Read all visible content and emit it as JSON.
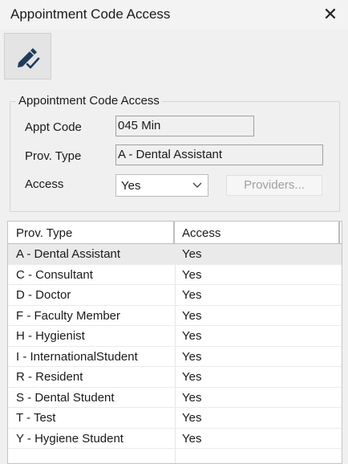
{
  "window": {
    "title": "Appointment Code Access",
    "close_glyph": "✕"
  },
  "toolbar": {
    "edit_icon": "pen-check-icon"
  },
  "group": {
    "label": "Appointment Code Access",
    "appt_code_label": "Appt Code",
    "appt_code_value": "045 Min",
    "prov_type_label": "Prov. Type",
    "prov_type_value": "A - Dental Assistant",
    "access_label": "Access",
    "access_value": "Yes",
    "providers_button": "Providers..."
  },
  "grid": {
    "columns": [
      "Prov. Type",
      "Access"
    ],
    "rows": [
      {
        "prov_type": "A - Dental Assistant",
        "access": "Yes"
      },
      {
        "prov_type": "C - Consultant",
        "access": "Yes"
      },
      {
        "prov_type": "D - Doctor",
        "access": "Yes"
      },
      {
        "prov_type": "F - Faculty Member",
        "access": "Yes"
      },
      {
        "prov_type": "H - Hygienist",
        "access": "Yes"
      },
      {
        "prov_type": "I - InternationalStudent",
        "access": "Yes"
      },
      {
        "prov_type": "R - Resident",
        "access": "Yes"
      },
      {
        "prov_type": "S - Dental Student",
        "access": "Yes"
      },
      {
        "prov_type": "T - Test",
        "access": "Yes"
      },
      {
        "prov_type": "Y - Hygiene Student",
        "access": "Yes"
      }
    ],
    "selected_row": 0
  }
}
